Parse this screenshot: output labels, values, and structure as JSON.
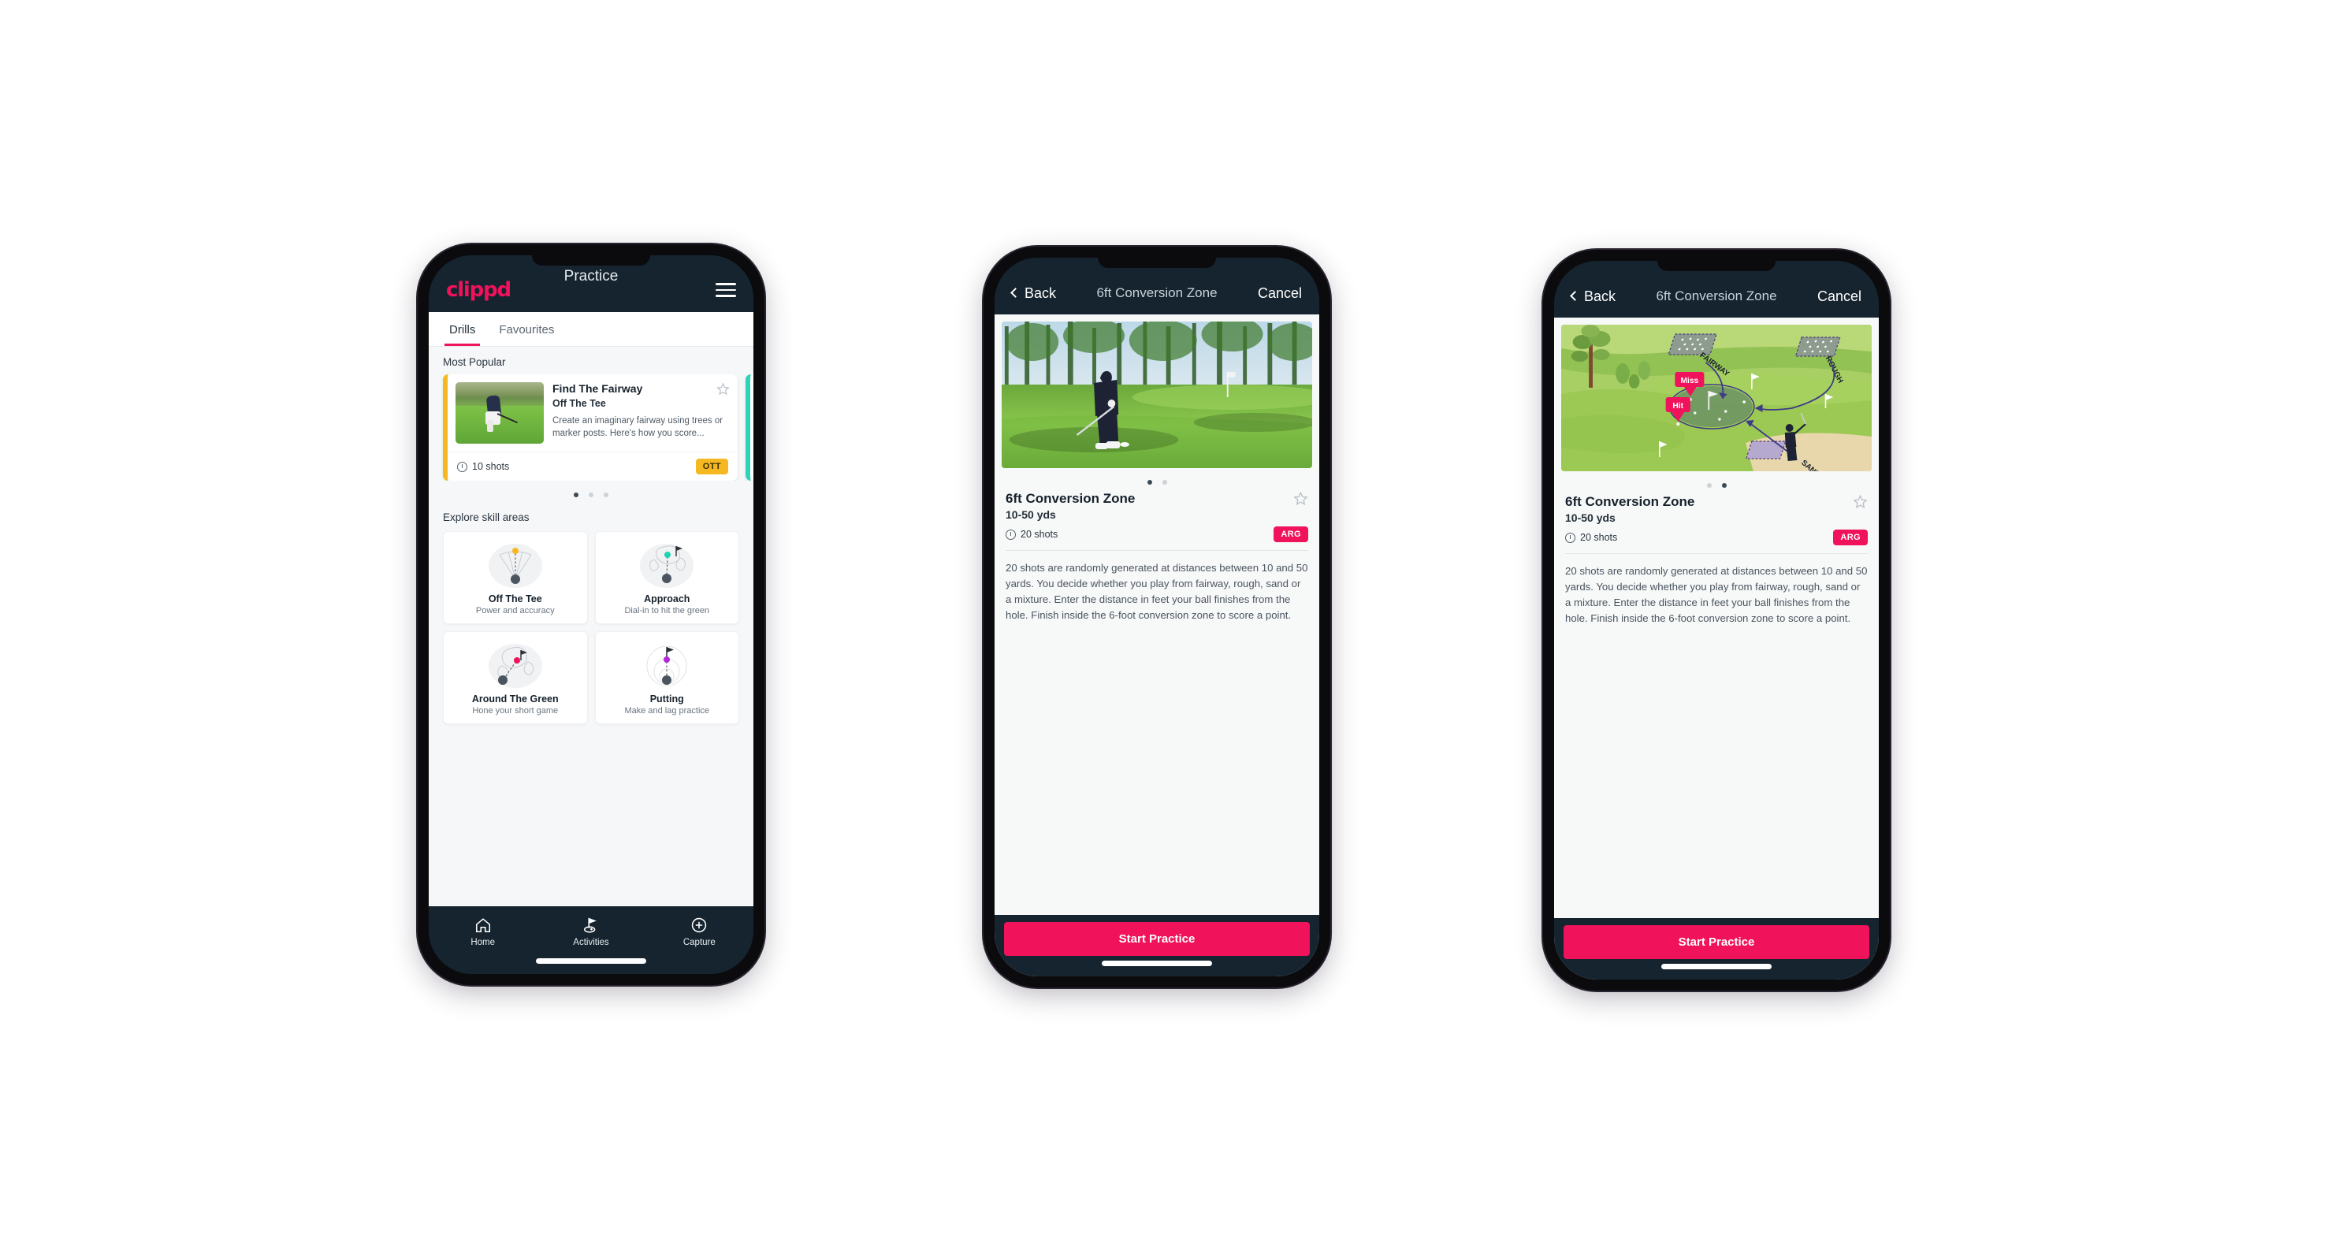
{
  "theme": {
    "navy": "#15242f",
    "pink": "#f0125a",
    "amber": "#f5b820",
    "teal": "#2fd4b5",
    "page_bg": "#ffffff",
    "screen_bg": "#f6f7f8"
  },
  "phone1": {
    "header": {
      "logo": "clippd",
      "title": "Practice",
      "menu_icon": "hamburger-menu-icon"
    },
    "tabs": [
      {
        "label": "Drills",
        "active": true
      },
      {
        "label": "Favourites",
        "active": false
      }
    ],
    "most_popular": {
      "section_label": "Most Popular",
      "card": {
        "title": "Find The Fairway",
        "subtitle": "Off The Tee",
        "description": "Create an imaginary fairway using trees or marker posts. Here's how you score...",
        "shots": "10 shots",
        "badge": "OTT",
        "badge_color": "#f5b820",
        "accent_color": "#f5b820",
        "star_icon": "star-outline-icon",
        "clock_icon": "clock-icon"
      },
      "dots": [
        true,
        false,
        false
      ]
    },
    "explore": {
      "section_label": "Explore skill areas",
      "cards": [
        {
          "name": "Off The Tee",
          "desc": "Power and accuracy",
          "icon": "tee-shot-fan-icon",
          "dot_color": "#f5b820"
        },
        {
          "name": "Approach",
          "desc": "Dial-in to hit the green",
          "icon": "approach-green-icon",
          "dot_color": "#22d3b0"
        },
        {
          "name": "Around The Green",
          "desc": "Hone your short game",
          "icon": "chip-around-green-icon",
          "dot_color": "#f0125a"
        },
        {
          "name": "Putting",
          "desc": "Make and lag practice",
          "icon": "putting-rings-icon",
          "dot_color": "#b429d6"
        }
      ]
    },
    "bottom_nav": [
      {
        "label": "Home",
        "icon": "home-icon",
        "active": false
      },
      {
        "label": "Activities",
        "icon": "golf-flag-icon",
        "active": true
      },
      {
        "label": "Capture",
        "icon": "plus-circle-icon",
        "active": false
      }
    ]
  },
  "phone2": {
    "nav": {
      "back_label": "Back",
      "back_icon": "chevron-left-icon",
      "title": "6ft Conversion Zone",
      "cancel_label": "Cancel"
    },
    "media": {
      "type": "photo",
      "alt": "golfer-chipping-photo"
    },
    "dots": [
      true,
      false
    ],
    "detail": {
      "title": "6ft Conversion Zone",
      "yardage": "10-50 yds",
      "shots": "20 shots",
      "badge": "ARG",
      "badge_color": "#f0125a",
      "star_icon": "star-outline-icon",
      "clock_icon": "clock-icon",
      "description": "20 shots are randomly generated at distances between 10 and 50 yards. You decide whether you play from fairway, rough, sand or a mixture. Enter the distance in feet your ball finishes from the hole. Finish inside the 6-foot conversion zone to score a point."
    },
    "cta": "Start Practice"
  },
  "phone3": {
    "nav": {
      "back_label": "Back",
      "back_icon": "chevron-left-icon",
      "title": "6ft Conversion Zone",
      "cancel_label": "Cancel"
    },
    "media": {
      "type": "illustration",
      "alt": "golf-course-diagram",
      "labels": {
        "fairway": "FAIRWAY",
        "rough": "ROUGH",
        "sand": "SAND",
        "miss": "Miss",
        "hit": "Hit"
      }
    },
    "dots": [
      false,
      true
    ],
    "detail": {
      "title": "6ft Conversion Zone",
      "yardage": "10-50 yds",
      "shots": "20 shots",
      "badge": "ARG",
      "badge_color": "#f0125a",
      "star_icon": "star-outline-icon",
      "clock_icon": "clock-icon",
      "description": "20 shots are randomly generated at distances between 10 and 50 yards. You decide whether you play from fairway, rough, sand or a mixture. Enter the distance in feet your ball finishes from the hole. Finish inside the 6-foot conversion zone to score a point."
    },
    "cta": "Start Practice"
  }
}
